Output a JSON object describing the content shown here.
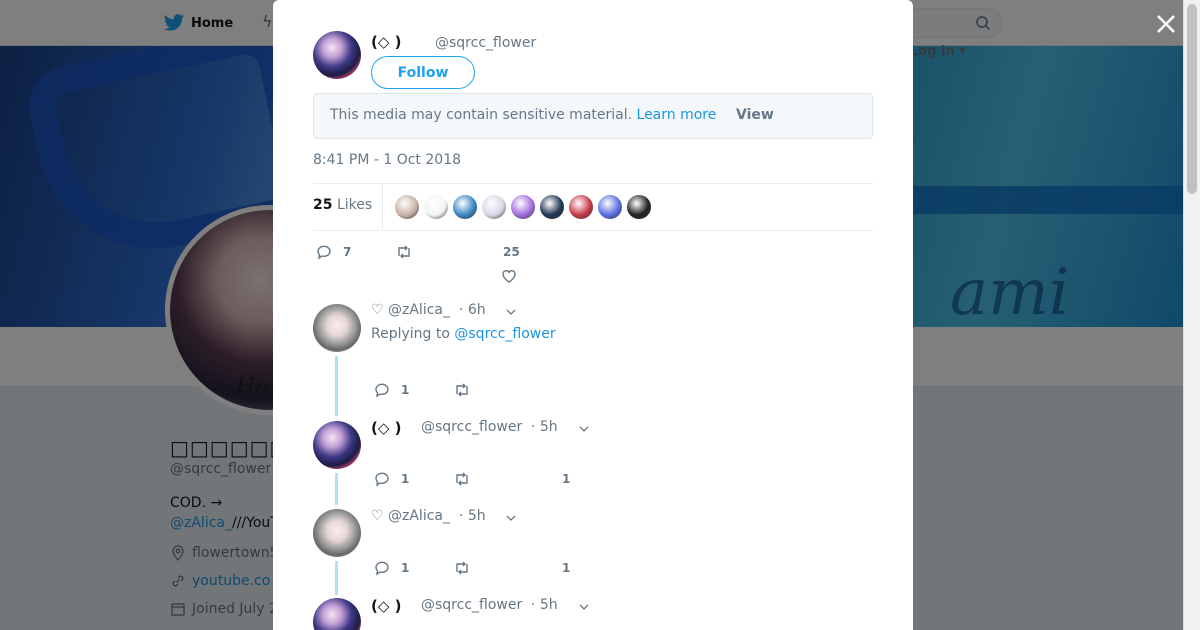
{
  "topnav": {
    "home_label": "Home",
    "login_label": "Log in"
  },
  "profile": {
    "display_name": "□□□□□□(□<",
    "handle": "@sqrcc_flower",
    "bio_line1": "COD. →",
    "bio_link": "@zAlica_",
    "bio_rest": "///YouT",
    "location": "flowertown5",
    "website": "youtube.co",
    "joined": "Joined July 2",
    "banner_text": "ami"
  },
  "tweet": {
    "author_name": "(◇ )",
    "author_handle": "@sqrcc_flower",
    "follow_label": "Follow",
    "sensitive_text": "This media may contain sensitive material.",
    "learn_more": "Learn more",
    "view_label": "View",
    "timestamp": "8:41 PM - 1 Oct 2018",
    "likes_count": "25",
    "likes_label": "Likes",
    "reply_count": "7",
    "like_action_count": "25"
  },
  "likers": [
    {
      "color": "#c9b2a8"
    },
    {
      "color": "#f4f4f4"
    },
    {
      "color": "#3a86c4"
    },
    {
      "color": "#d8d8e8"
    },
    {
      "color": "#a26ee0"
    },
    {
      "color": "#1f3656"
    },
    {
      "color": "#c83a4a"
    },
    {
      "color": "#5a6ee0"
    },
    {
      "color": "#222222"
    }
  ],
  "replies": [
    {
      "name": "♡ @zAlica_",
      "time": "· 6h",
      "replying_label": "Replying to",
      "replying_handle": "@sqrcc_flower",
      "reply_count": "1"
    },
    {
      "name": "(◇ )",
      "handle": "@sqrcc_flower",
      "time": "· 5h",
      "reply_count": "1",
      "like_count": "1"
    },
    {
      "name": "♡ @zAlica_",
      "time": "· 5h",
      "reply_count": "1",
      "like_count": "1"
    },
    {
      "name": "(◇ )",
      "handle": "@sqrcc_flower",
      "time": "· 5h"
    }
  ],
  "colors": {
    "accent": "#1da1f2",
    "link": "#1b95e0",
    "muted": "#657786",
    "thread": "#b3dff6"
  }
}
